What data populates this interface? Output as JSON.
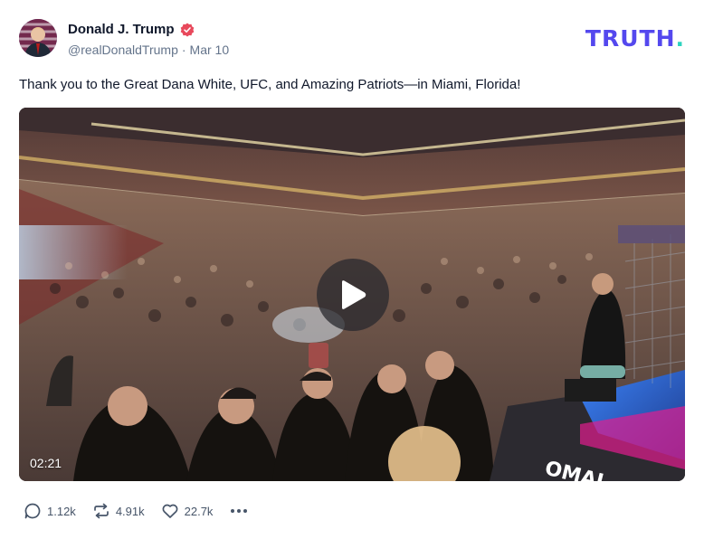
{
  "author": {
    "name": "Donald J. Trump",
    "handle": "@realDonaldTrump",
    "separator": "·",
    "date": "Mar 10"
  },
  "brand": {
    "logo_text": "TRUTH",
    "logo_dot": "."
  },
  "post": {
    "text": "Thank you to the Great Dana White, UFC, and Amazing Patriots—in Miami, Florida!"
  },
  "video": {
    "duration": "02:21",
    "banner_text": "OMAL"
  },
  "actions": {
    "replies": "1.12k",
    "retruths": "4.91k",
    "likes": "22.7k"
  },
  "colors": {
    "verified": "#e8495c",
    "brand": "#5448ee",
    "brand_dot": "#2dd4bf",
    "muted_text": "#64748b"
  },
  "icons": [
    "verified-icon",
    "play-icon",
    "reply-icon",
    "retruth-icon",
    "like-icon",
    "more-icon"
  ]
}
